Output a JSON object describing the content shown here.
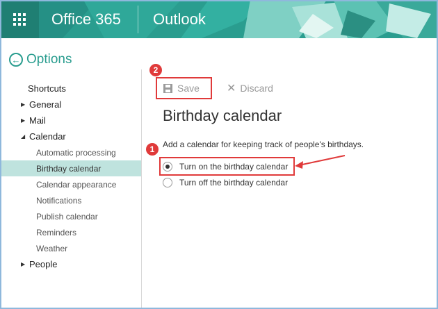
{
  "header": {
    "brand": "Office 365",
    "app": "Outlook"
  },
  "options": {
    "title": "Options",
    "back_icon": "back-arrow-icon"
  },
  "sidebar": {
    "shortcuts": "Shortcuts",
    "general": "General",
    "mail": "Mail",
    "calendar": "Calendar",
    "calendar_items": [
      "Automatic processing",
      "Birthday calendar",
      "Calendar appearance",
      "Notifications",
      "Publish calendar",
      "Reminders",
      "Weather"
    ],
    "people": "People",
    "selected": "Birthday calendar"
  },
  "toolbar": {
    "save_label": "Save",
    "discard_label": "Discard"
  },
  "main": {
    "heading": "Birthday calendar",
    "description": "Add a calendar for keeping track of people's birthdays.",
    "options": [
      {
        "label": "Turn on the birthday calendar",
        "checked": true
      },
      {
        "label": "Turn off the birthday calendar",
        "checked": false
      }
    ]
  },
  "annotations": {
    "step1": "1",
    "step2": "2",
    "color": "#e03a3a"
  },
  "colors": {
    "accent": "#2a9d8f",
    "selected_bg": "#bfe3de"
  }
}
